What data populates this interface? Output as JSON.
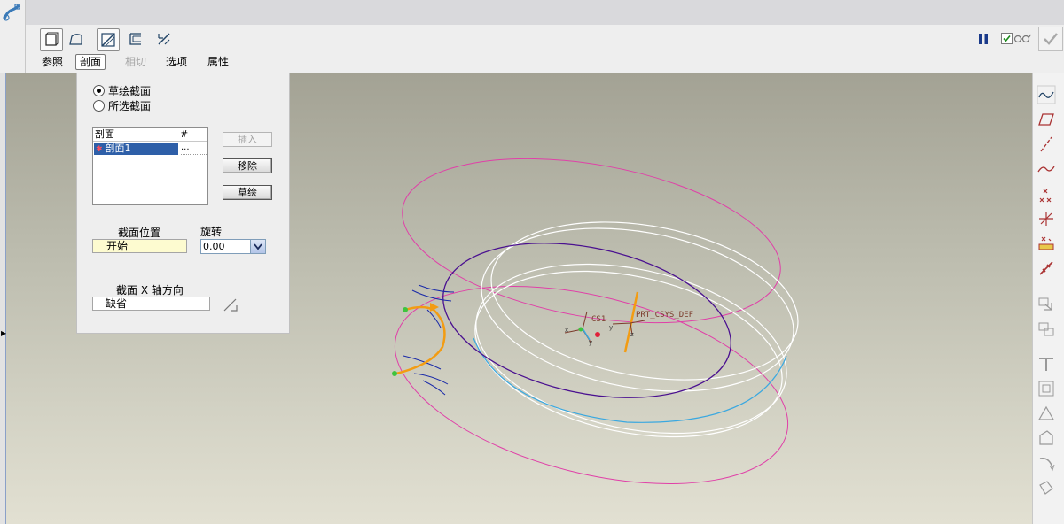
{
  "dashboard": {
    "tools": [
      {
        "name": "solid-icon",
        "pressed": true
      },
      {
        "name": "surface-icon",
        "pressed": false
      },
      {
        "name": "remove-material-icon",
        "pressed": true
      },
      {
        "name": "thicken-icon",
        "pressed": false
      },
      {
        "name": "create-surface-icon",
        "pressed": false
      }
    ],
    "tabs": {
      "references": "参照",
      "sections": "剖面",
      "tangency": "相切",
      "options": "选项",
      "properties": "属性"
    },
    "active_tab": "剖面"
  },
  "sections_panel": {
    "radio_sketched": "草绘截面",
    "radio_selected": "所选截面",
    "radio_selected_value": "草绘截面",
    "table": {
      "col_section": "剖面",
      "col_number": "#",
      "rows": [
        {
          "name": "剖面1",
          "number": "...",
          "selected": true
        }
      ]
    },
    "buttons": {
      "insert": "插入",
      "remove": "移除",
      "sketch": "草绘"
    },
    "section_location_label": "截面位置",
    "section_location_value": "开始",
    "rotation_label": "旋转",
    "rotation_value": "0.00",
    "x_axis_label": "截面 X 轴方向",
    "x_axis_value": "缺省"
  },
  "scene": {
    "csys_label": "CS1",
    "prt_csys_label": "PRT_CSYS_DEF",
    "colors": {
      "magenta": "#e040a8",
      "purple": "#4a1090",
      "white": "#ffffff",
      "blue_arc": "#3aa8e0",
      "orange": "#f39c12",
      "green_point": "#3ec43e",
      "sketch_blue": "#1a2aa8"
    }
  },
  "right_toolbar": [
    "sketched-curve-icon",
    "datum-plane-icon",
    "datum-axis-icon",
    "datum-curve-icon",
    "datum-point-icon",
    "coordinate-system-icon",
    "analysis-icon",
    "annotation-icon",
    "mirror-icon",
    "merge-icon",
    "trim-icon",
    "offset-icon",
    "thicken-icon",
    "solidify-icon",
    "extend-icon",
    "intersect-icon"
  ]
}
